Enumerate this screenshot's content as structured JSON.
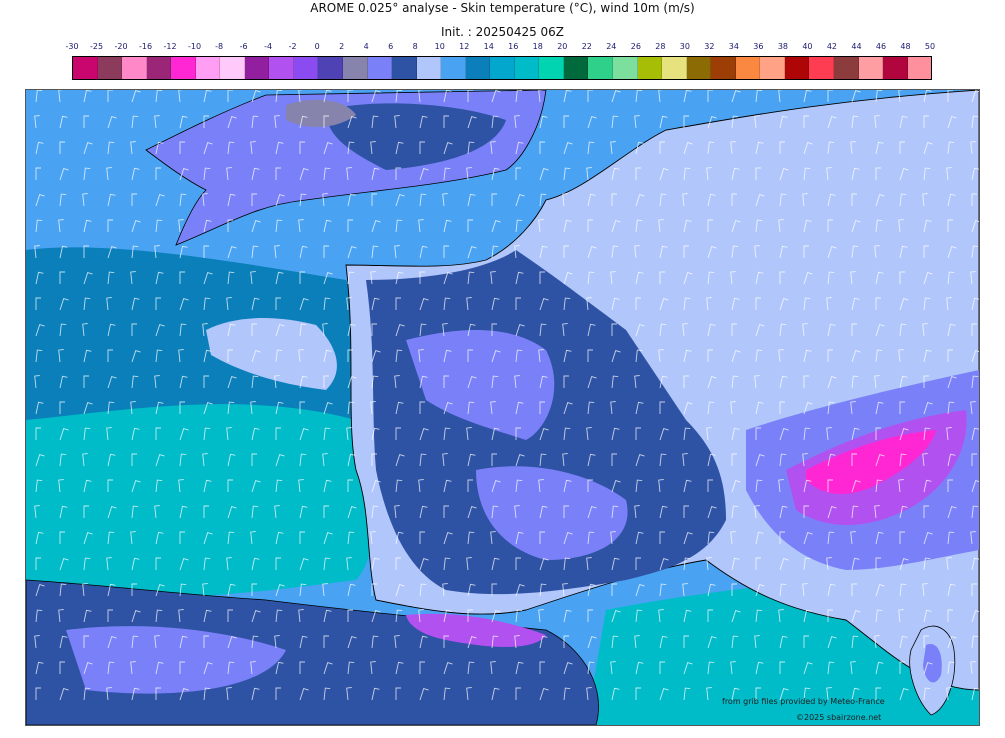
{
  "header": {
    "title": "AROME 0.025° analyse - Skin temperature (°C), wind 10m (m/s)",
    "init": "Init. : 20250425 06Z"
  },
  "legend": {
    "labels": [
      "-30",
      "-25",
      "-20",
      "-16",
      "-12",
      "-10",
      "-8",
      "-6",
      "-4",
      "-2",
      "0",
      "2",
      "4",
      "6",
      "8",
      "10",
      "12",
      "14",
      "16",
      "18",
      "20",
      "22",
      "24",
      "26",
      "28",
      "30",
      "32",
      "34",
      "36",
      "38",
      "40",
      "42",
      "44",
      "46",
      "48",
      "50"
    ],
    "colors": [
      "#c8066d",
      "#8c3b5c",
      "#ff88c8",
      "#9b2577",
      "#ff27d4",
      "#ff9ef2",
      "#ffcaf9",
      "#911fa0",
      "#b152f0",
      "#8a4cf1",
      "#4e42b5",
      "#8684ac",
      "#7a80f8",
      "#2e52a4",
      "#b1c6fb",
      "#4aa3f2",
      "#0a7fba",
      "#03a6cd",
      "#00bcc9",
      "#00d4b0",
      "#016a3c",
      "#2ed08a",
      "#7ddf9d",
      "#a6be06",
      "#e6e37e",
      "#8c6b05",
      "#9e3e07",
      "#fb8840",
      "#ffa285",
      "#ae0606",
      "#fe3c52",
      "#8d3c3d",
      "#fe9ea3",
      "#b0053d",
      "#fe8f9c"
    ]
  },
  "map": {
    "colors": {
      "sea_west": "#4aa3f2",
      "sea_deep": "#0a7fba",
      "sea_warm": "#00bcc9",
      "land_cool": "#b1c6fb",
      "land_mid": "#2e52a4",
      "land_light_purple": "#7a80f8",
      "land_gray": "#8684ac",
      "mountain_magenta": "#b152f0",
      "mountain_hot": "#ff27d4",
      "coastline": "#000000",
      "wind": "#ffffff"
    }
  },
  "credits": {
    "source": "from grib files provided by Meteo-France",
    "copyright": "©2025 sbairzone.net"
  }
}
